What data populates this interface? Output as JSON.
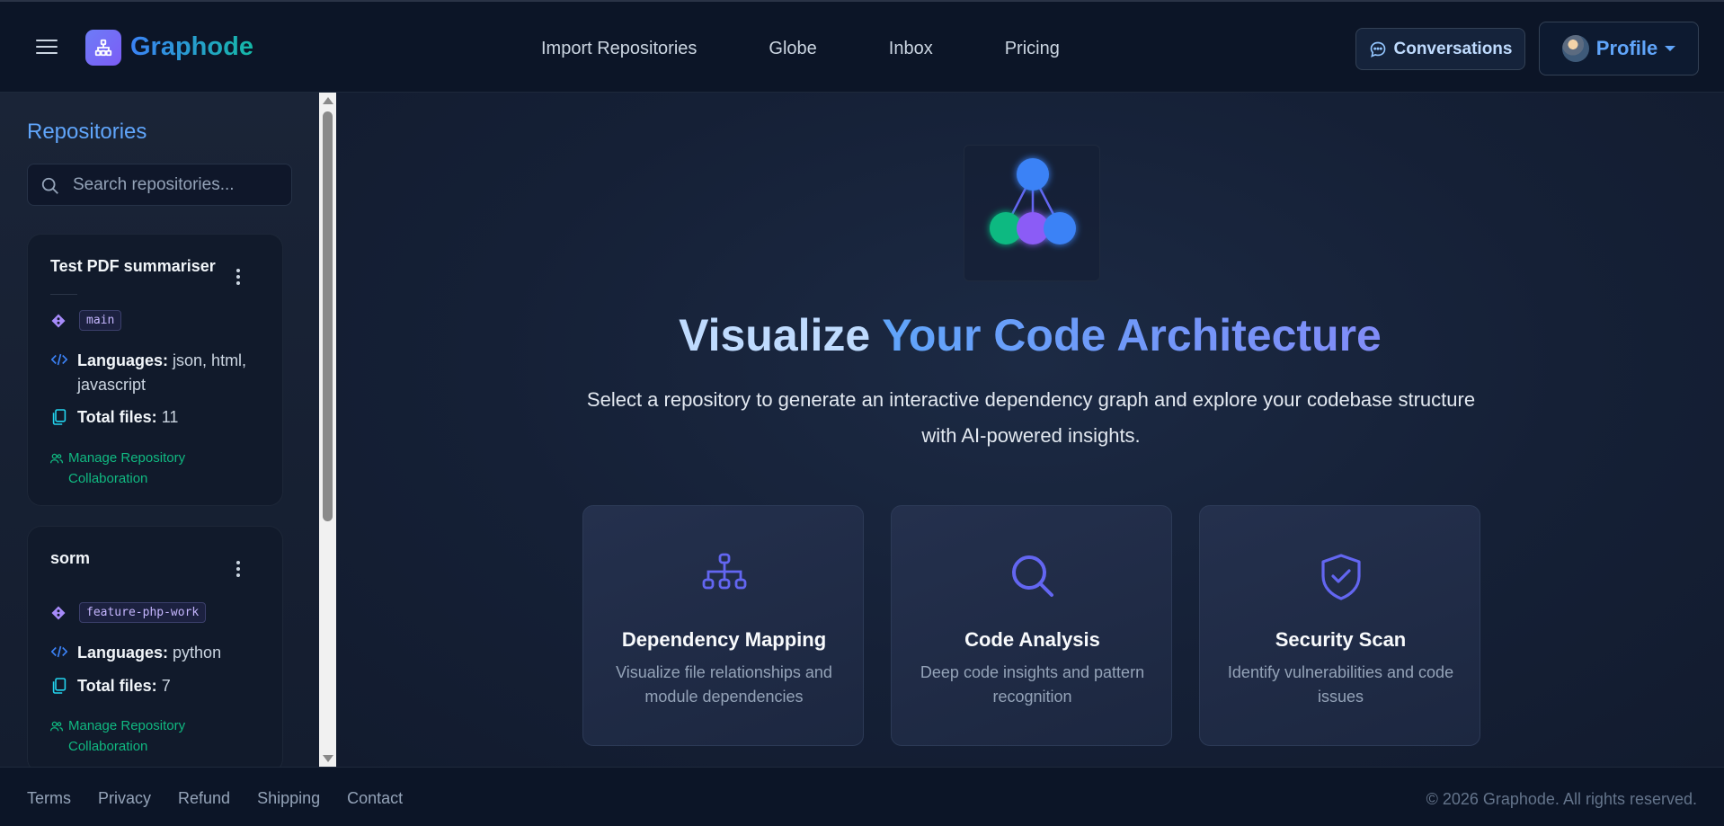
{
  "navbar": {
    "brand": "Graphode",
    "links": [
      "Import Repositories",
      "Globe",
      "Inbox",
      "Pricing"
    ],
    "conversations_label": "Conversations",
    "profile_label": "Profile"
  },
  "sidebar": {
    "title": "Repositories",
    "search_placeholder": "Search repositories...",
    "repos": [
      {
        "name": "Test PDF summariser",
        "branch": "main",
        "languages_label": "Languages:",
        "languages": "json, html, javascript",
        "files_label": "Total files:",
        "files": "11",
        "collab_label": "Manage Repository Collaboration"
      },
      {
        "name": "sorm",
        "branch": "feature-php-work",
        "languages_label": "Languages:",
        "languages": "python",
        "files_label": "Total files:",
        "files": "7",
        "collab_label": "Manage Repository Collaboration"
      }
    ]
  },
  "hero": {
    "title_part1": "Visualize",
    "title_part2": "Your Code Architecture",
    "subtitle": "Select a repository to generate an interactive dependency graph and explore your codebase structure with AI-powered insights."
  },
  "features": [
    {
      "icon": "sitemap-icon",
      "title": "Dependency Mapping",
      "desc": "Visualize file relationships and module dependencies"
    },
    {
      "icon": "magnifier-icon",
      "title": "Code Analysis",
      "desc": "Deep code insights and pattern recognition"
    },
    {
      "icon": "shield-check-icon",
      "title": "Security Scan",
      "desc": "Identify vulnerabilities and code issues"
    }
  ],
  "footer": {
    "links": [
      "Terms",
      "Privacy",
      "Refund",
      "Shipping",
      "Contact"
    ],
    "copyright": "© 2026 Graphode. All rights reserved."
  },
  "colors": {
    "accent": "#60a5fa",
    "success": "#10b981",
    "background": "#0f172a"
  }
}
